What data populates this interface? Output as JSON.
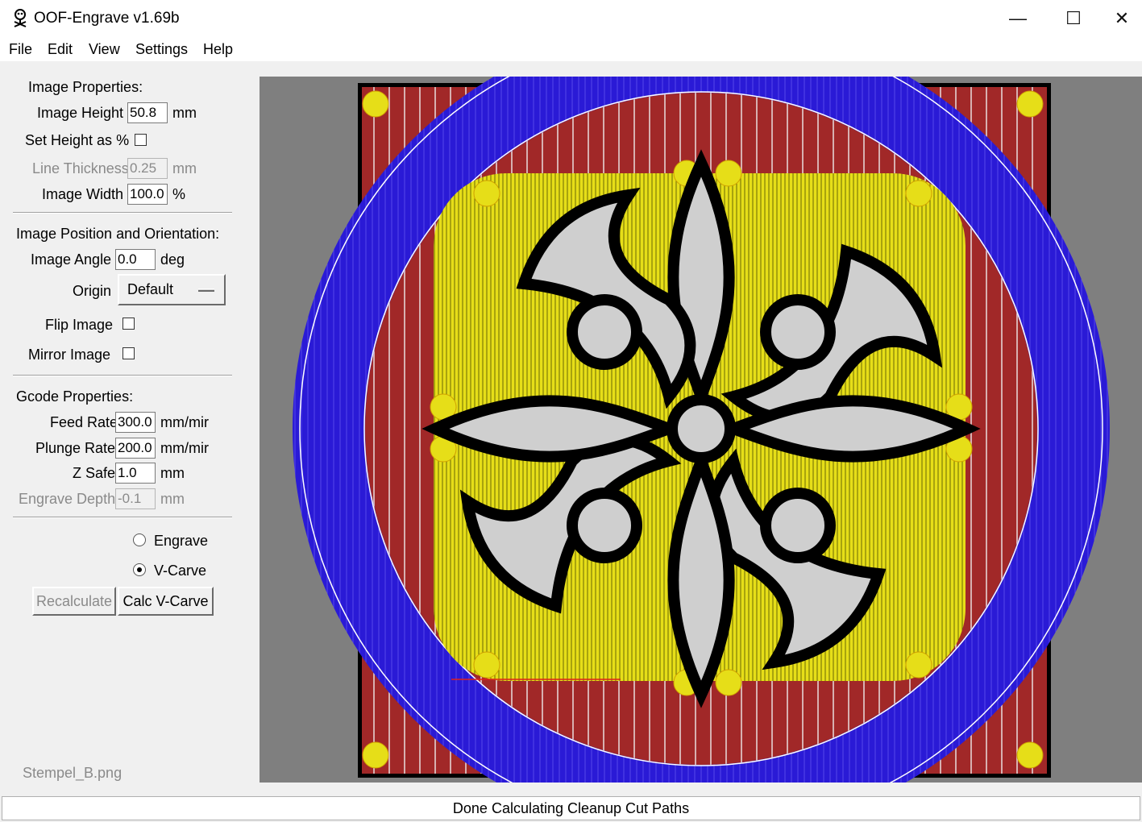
{
  "window": {
    "title": "OOF-Engrave v1.69b",
    "minimize": "—",
    "maximize": "☐",
    "close": "✕"
  },
  "menu": [
    "File",
    "Edit",
    "View",
    "Settings",
    "Help"
  ],
  "image_properties": {
    "heading": "Image Properties:",
    "height_label": "Image Height",
    "height_value": "50.8",
    "height_unit": "mm",
    "set_height_pct_label": "Set Height as %",
    "set_height_pct_checked": false,
    "line_thickness_label": "Line Thickness",
    "line_thickness_value": "0.25",
    "line_thickness_unit": "mm",
    "width_label": "Image Width",
    "width_value": "100.0",
    "width_unit": "%"
  },
  "position": {
    "heading": "Image Position and Orientation:",
    "angle_label": "Image Angle",
    "angle_value": "0.0",
    "angle_unit": "deg",
    "origin_label": "Origin",
    "origin_value": "Default",
    "flip_label": "Flip Image",
    "flip_checked": false,
    "mirror_label": "Mirror Image",
    "mirror_checked": false
  },
  "gcode": {
    "heading": "Gcode Properties:",
    "feed_label": "Feed Rate",
    "feed_value": "300.0",
    "feed_unit": "mm/mir",
    "plunge_label": "Plunge Rate",
    "plunge_value": "200.0",
    "plunge_unit": "mm/mir",
    "zsafe_label": "Z Safe",
    "zsafe_value": "1.0",
    "zsafe_unit": "mm",
    "depth_label": "Engrave Depth",
    "depth_value": "-0.1",
    "depth_unit": "mm"
  },
  "mode": {
    "engrave_label": "Engrave",
    "vcarve_label": "V-Carve",
    "selected": "V-Carve"
  },
  "buttons": {
    "recalculate": "Recalculate",
    "calc_vcarve": "Calc V-Carve"
  },
  "file_name": "Stempel_B.png",
  "status": "Done Calculating Cleanup Cut Paths",
  "colors": {
    "canvas_bg": "#7f7f7f",
    "stock": "#a12828",
    "cleanup": "#2a1ad6",
    "fill": "#e6de18",
    "image": "#cfcfcf"
  }
}
